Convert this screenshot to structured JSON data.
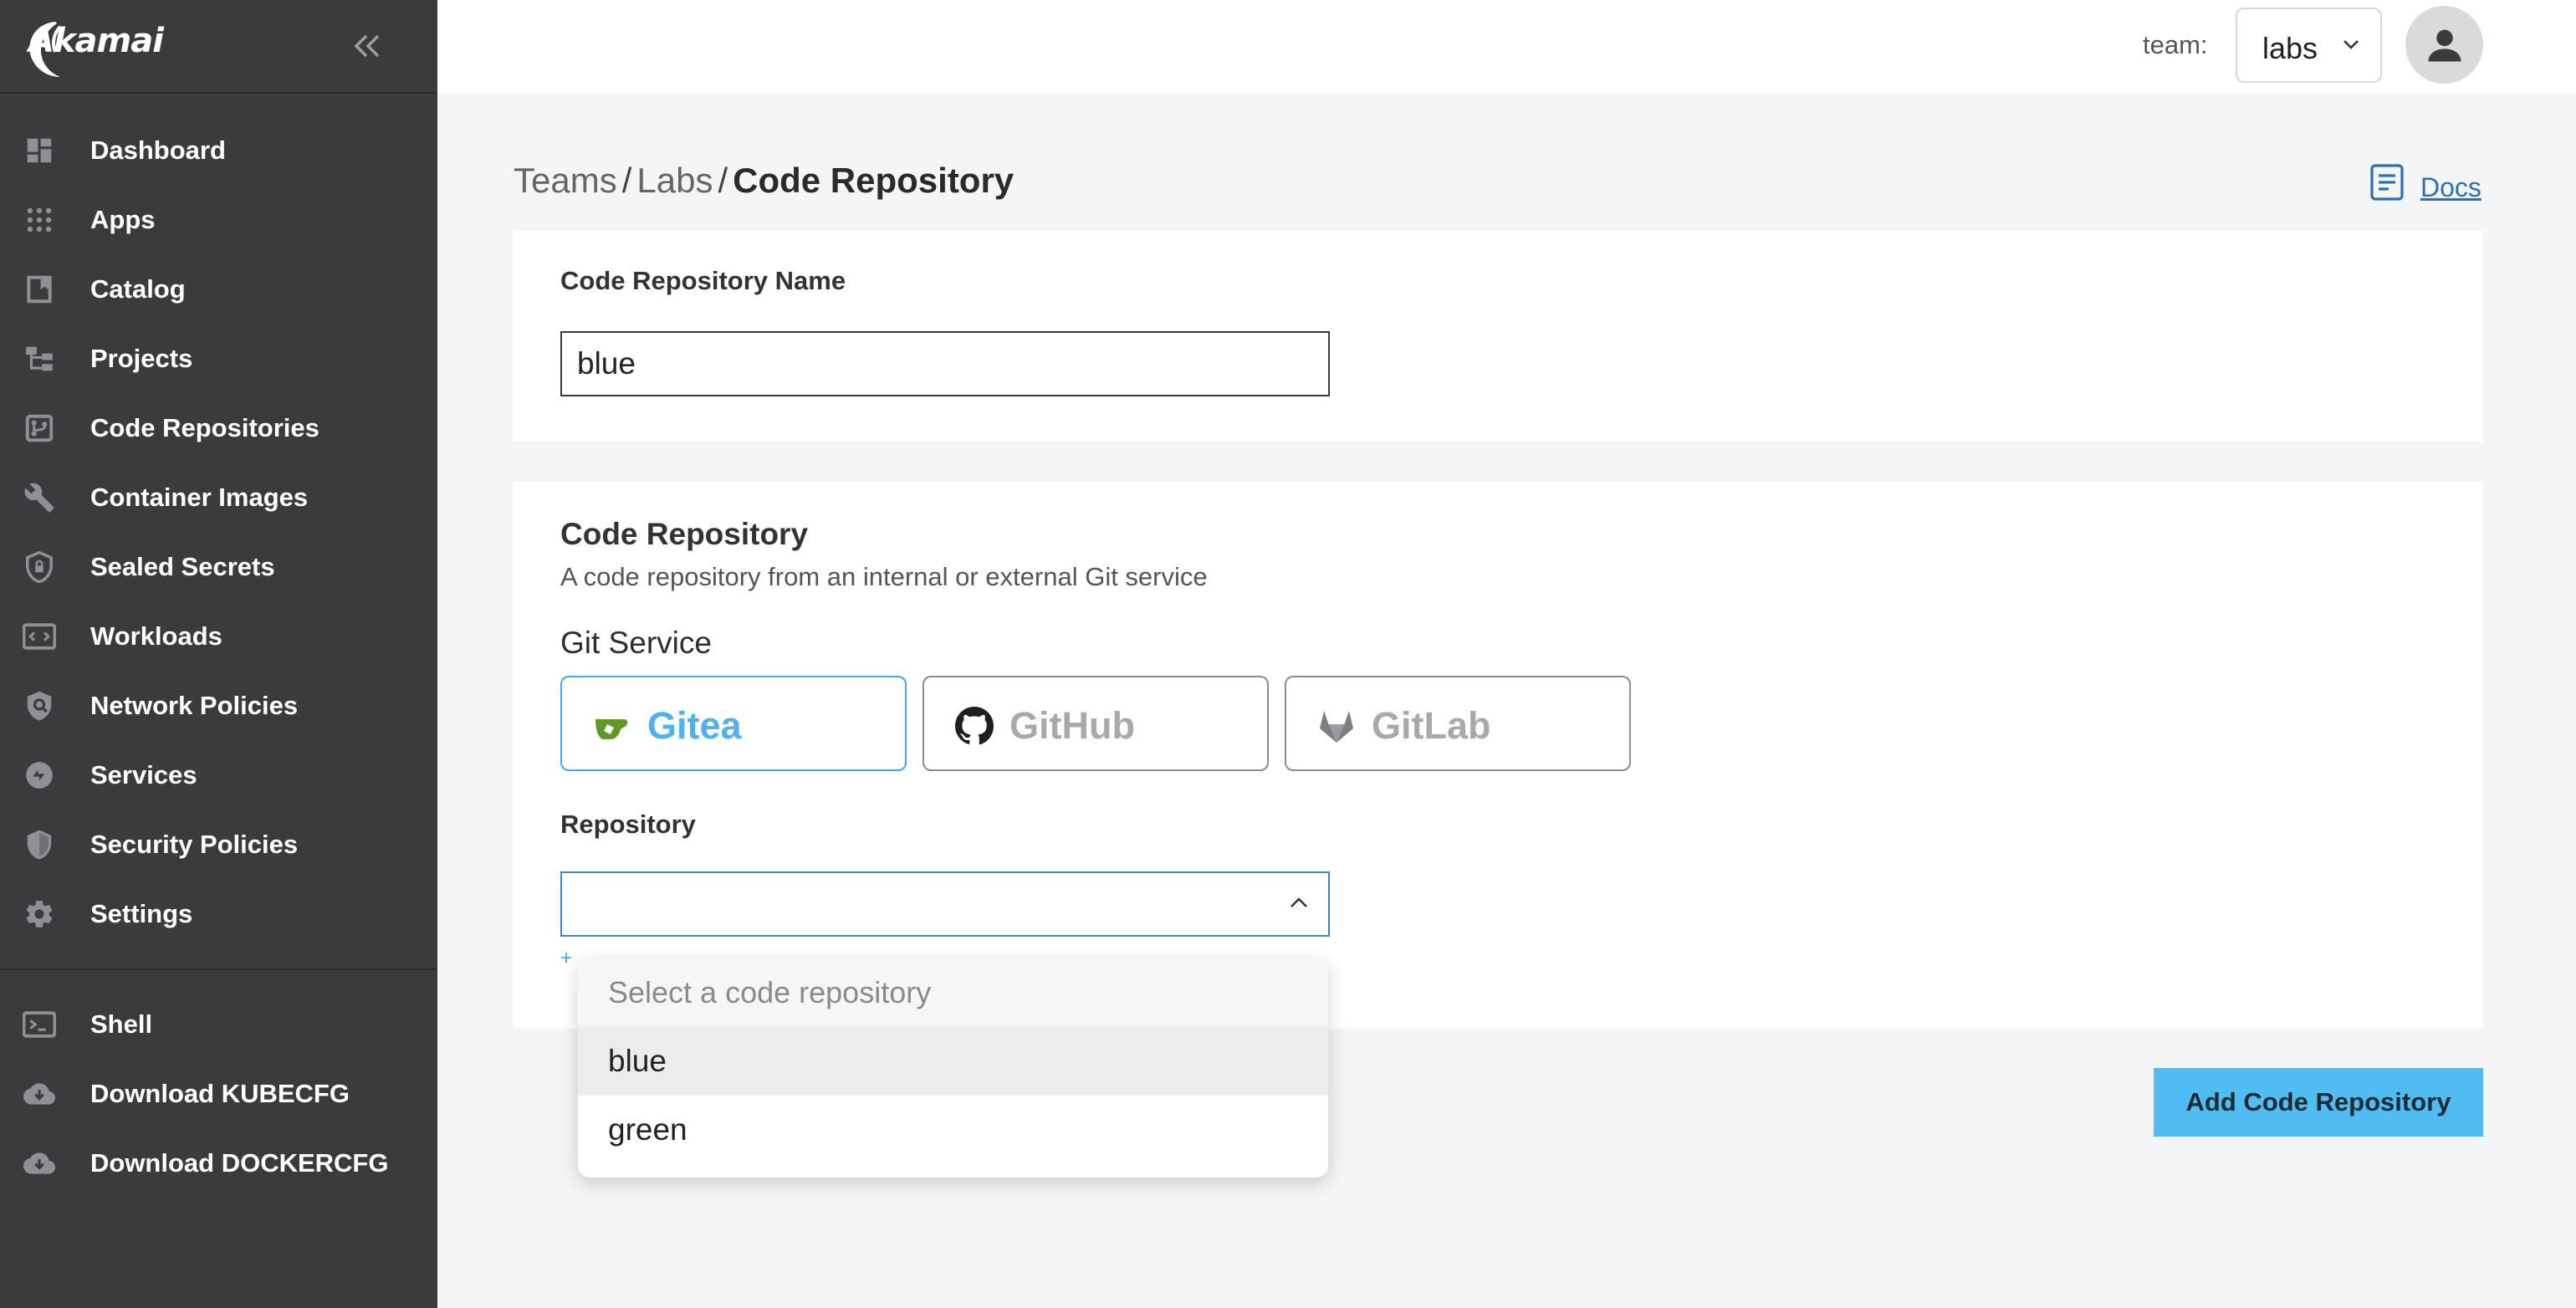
{
  "brand": {
    "logo_text": "Akamai"
  },
  "sidebar": {
    "items": [
      {
        "label": "Dashboard",
        "icon": "dashboard-icon"
      },
      {
        "label": "Apps",
        "icon": "apps-grid-icon"
      },
      {
        "label": "Catalog",
        "icon": "book-icon"
      },
      {
        "label": "Projects",
        "icon": "tree-icon"
      },
      {
        "label": "Code Repositories",
        "icon": "git-branch-icon"
      },
      {
        "label": "Container Images",
        "icon": "wrench-icon"
      },
      {
        "label": "Sealed Secrets",
        "icon": "shield-lock-icon"
      },
      {
        "label": "Workloads",
        "icon": "code-box-icon"
      },
      {
        "label": "Network Policies",
        "icon": "shield-search-icon"
      },
      {
        "label": "Services",
        "icon": "services-icon"
      },
      {
        "label": "Security Policies",
        "icon": "shield-icon"
      },
      {
        "label": "Settings",
        "icon": "gear-icon"
      }
    ],
    "bottom_items": [
      {
        "label": "Shell",
        "icon": "terminal-icon"
      },
      {
        "label": "Download KUBECFG",
        "icon": "cloud-download-icon"
      },
      {
        "label": "Download DOCKERCFG",
        "icon": "cloud-download-icon"
      }
    ]
  },
  "topbar": {
    "team_label": "team:",
    "team_value": "labs"
  },
  "breadcrumb": {
    "items": [
      "Teams",
      "Labs"
    ],
    "current": "Code Repository"
  },
  "docs": {
    "label": "Docs"
  },
  "form": {
    "name_label": "Code Repository Name",
    "name_value": "blue",
    "section_title": "Code Repository",
    "section_desc": "A code repository from an internal or external Git service",
    "git_service_label": "Git Service",
    "services": [
      {
        "label": "Gitea",
        "selected": true
      },
      {
        "label": "GitHub",
        "selected": false
      },
      {
        "label": "GitLab",
        "selected": false
      }
    ],
    "repository_label": "Repository",
    "repository_value": "",
    "plus_hint": "+"
  },
  "dropdown": {
    "placeholder": "Select a code repository",
    "options": [
      "blue",
      "green"
    ],
    "highlighted": "blue"
  },
  "actions": {
    "submit_label": "Add Code Repository"
  },
  "colors": {
    "accent": "#4fbdf2",
    "sidebar_bg": "#3b3b3d",
    "selected_border": "#3fa9f5"
  }
}
